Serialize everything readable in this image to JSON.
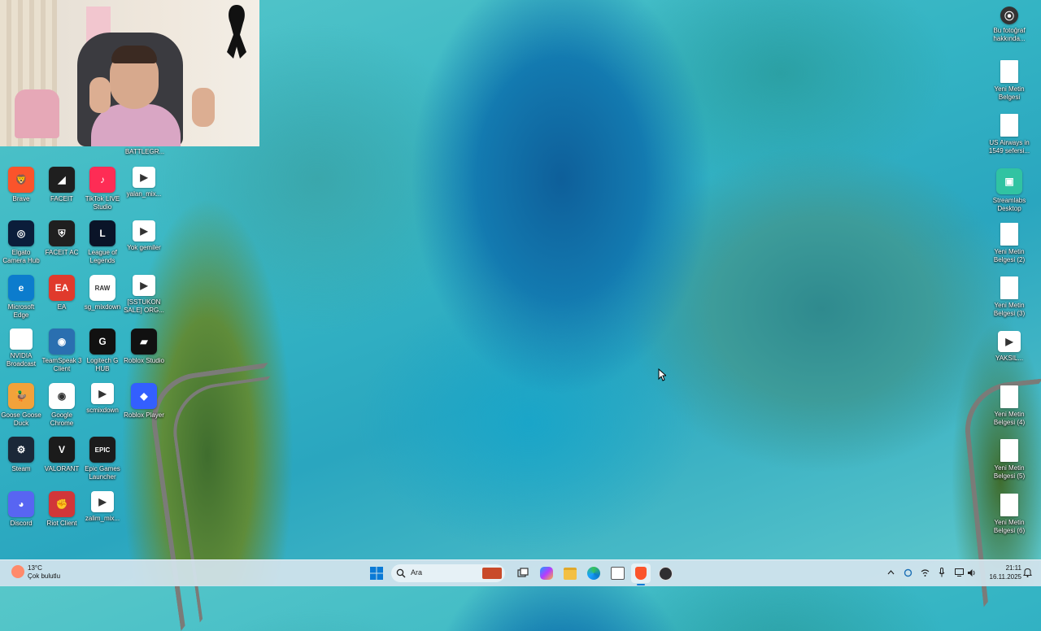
{
  "webcam": {
    "caption": "BATTLEGR..."
  },
  "desktop_left": [
    {
      "id": "brave",
      "label": "Brave",
      "color": "#fb542b",
      "glyph": "🦁"
    },
    {
      "id": "faceit",
      "label": "FACEIT",
      "color": "#1f1f1f",
      "glyph": "◢"
    },
    {
      "id": "tiktok-live",
      "label": "TikTok LIVE Studio",
      "color": "#fe2c55",
      "glyph": "♪"
    },
    {
      "id": "yalan",
      "label": "yalan_mix...",
      "color": "#ffffff",
      "glyph": "▶"
    },
    {
      "id": "elgato",
      "label": "Elgato Camera Hub",
      "color": "#0b1d3a",
      "glyph": "◎"
    },
    {
      "id": "faceit-ac",
      "label": "FACEIT AC",
      "color": "#1f1f1f",
      "glyph": "⛨"
    },
    {
      "id": "lol",
      "label": "League of Legends",
      "color": "#0a1428",
      "glyph": "L"
    },
    {
      "id": "yok",
      "label": "Yok gemiler",
      "color": "#ffffff",
      "glyph": "▶"
    },
    {
      "id": "edge",
      "label": "Microsoft Edge",
      "color": "#0c7ccd",
      "glyph": "e"
    },
    {
      "id": "ea",
      "label": "EA",
      "color": "#e03a2c",
      "glyph": "EA"
    },
    {
      "id": "sgmix",
      "label": "sg_mixdown",
      "color": "#ffffff",
      "glyph": "RAW"
    },
    {
      "id": "sstukon",
      "label": "[SSTUKON SALE] ORG...",
      "color": "#ffffff",
      "glyph": "▶"
    },
    {
      "id": "nvidia",
      "label": "NVIDIA Broadcast",
      "color": "#5b9c1b",
      "glyph": "▶"
    },
    {
      "id": "teamspeak",
      "label": "TeamSpeak 3 Client",
      "color": "#2a6fb0",
      "glyph": "◉"
    },
    {
      "id": "ghub",
      "label": "Logitech G HUB",
      "color": "#111111",
      "glyph": "G"
    },
    {
      "id": "roblox-studio",
      "label": "Roblox Studio",
      "color": "#111111",
      "glyph": "▰"
    },
    {
      "id": "goose",
      "label": "Goose Goose Duck",
      "color": "#f2a23a",
      "glyph": "🦆"
    },
    {
      "id": "chrome",
      "label": "Google Chrome",
      "color": "#ffffff",
      "glyph": "◉"
    },
    {
      "id": "scmix",
      "label": "scmixdown",
      "color": "#ffffff",
      "glyph": "▶"
    },
    {
      "id": "roblox-player",
      "label": "Roblox Player",
      "color": "#335fff",
      "glyph": "◆"
    },
    {
      "id": "steam",
      "label": "Steam",
      "color": "#1b2838",
      "glyph": "⚙"
    },
    {
      "id": "valorant",
      "label": "VALORANT",
      "color": "#1b1b1b",
      "glyph": "V"
    },
    {
      "id": "epic",
      "label": "Epic Games Launcher",
      "color": "#1c1c1c",
      "glyph": "EPIC"
    },
    {
      "id": "blank",
      "label": "",
      "color": "transparent",
      "glyph": ""
    },
    {
      "id": "discord",
      "label": "Discord",
      "color": "#5865f2",
      "glyph": "◕"
    },
    {
      "id": "riot",
      "label": "Riot Client",
      "color": "#d13639",
      "glyph": "✊"
    },
    {
      "id": "zalim",
      "label": "zalim_mix...",
      "color": "#ffffff",
      "glyph": "▶"
    }
  ],
  "desktop_right": [
    {
      "id": "bu-fotograf",
      "label": "Bu fotoğraf hakkında...",
      "type": "app",
      "color": "#333333",
      "glyph": "⦿"
    },
    {
      "id": "yeni-metin-1",
      "label": "Yeni Metin Belgesi",
      "type": "doc"
    },
    {
      "id": "us-airways",
      "label": "US Airways in 1549 sefersi...",
      "type": "doc"
    },
    {
      "id": "streamlabs",
      "label": "Streamlabs Desktop",
      "type": "app",
      "color": "#31c3a2",
      "glyph": "▣"
    },
    {
      "id": "yeni-metin-2",
      "label": "Yeni Metin Belgesi (2)",
      "type": "doc"
    },
    {
      "id": "yeni-metin-3",
      "label": "Yeni Metin Belgesi (3)",
      "type": "doc"
    },
    {
      "id": "yaksil",
      "label": "YAKSIL...",
      "type": "vid"
    },
    {
      "id": "yeni-metin-4",
      "label": "Yeni Metin Belgesi (4)",
      "type": "doc"
    },
    {
      "id": "yeni-metin-5",
      "label": "Yeni Metin Belgesi (5)",
      "type": "doc"
    },
    {
      "id": "yeni-metin-6",
      "label": "Yeni Metin Belgesi (6)",
      "type": "doc"
    }
  ],
  "taskbar": {
    "weather_temp": "13°C",
    "weather_desc": "Çok bulutlu",
    "search_placeholder": "Ara",
    "time": "21:11",
    "date": "16.11.2025"
  }
}
